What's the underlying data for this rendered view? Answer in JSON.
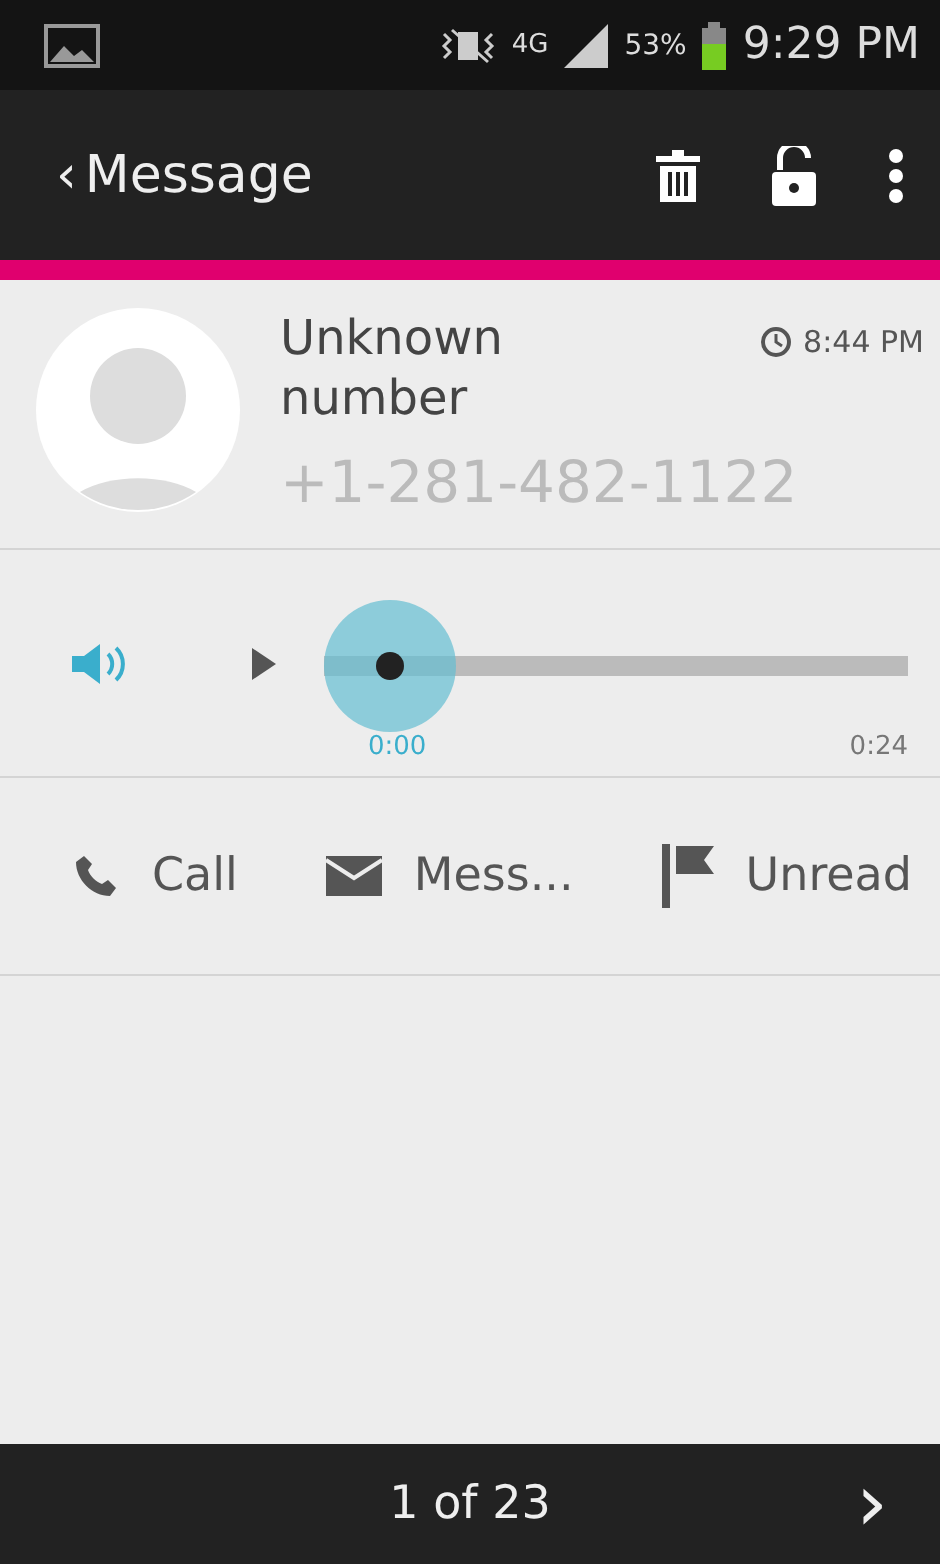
{
  "status_bar": {
    "network": "4G",
    "battery": "53%",
    "time": "9:29 PM"
  },
  "app_bar": {
    "back": "‹",
    "title": "Message"
  },
  "message": {
    "sender": "Unknown number",
    "time": "8:44 PM",
    "phone": "+1-281-482-1122"
  },
  "player": {
    "elapsed": "0:00",
    "duration": "0:24"
  },
  "actions": [
    {
      "label": "Call"
    },
    {
      "label": "Mess..."
    },
    {
      "label": "Unread"
    }
  ],
  "footer": {
    "pager": "1 of 23",
    "next": "›"
  }
}
